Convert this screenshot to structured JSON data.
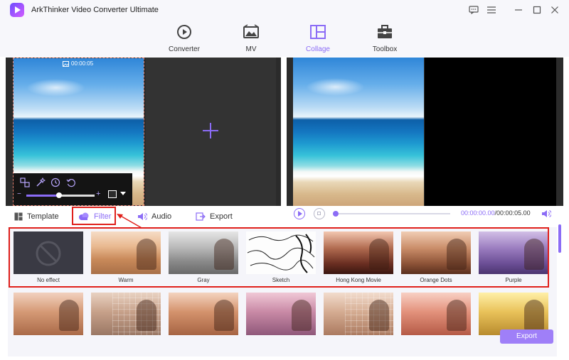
{
  "app": {
    "title": "ArkThinker Video Converter Ultimate"
  },
  "window_controls": [
    "feedback-icon",
    "menu-icon",
    "minimize-icon",
    "maximize-icon",
    "close-icon"
  ],
  "nav": {
    "tabs": [
      {
        "label": "Converter",
        "icon": "converter-icon"
      },
      {
        "label": "MV",
        "icon": "mv-icon"
      },
      {
        "label": "Collage",
        "icon": "collage-icon",
        "active": true
      },
      {
        "label": "Toolbox",
        "icon": "toolbox-icon"
      }
    ]
  },
  "preview": {
    "clip_duration": "00:00:05"
  },
  "tabs": {
    "template": "Template",
    "filter": "Filter",
    "audio": "Audio",
    "export": "Export"
  },
  "player": {
    "current_time": "00:00:00.00",
    "total_time": "/00:00:05.00"
  },
  "filters": {
    "row1": [
      "No effect",
      "Warm",
      "Gray",
      "Sketch",
      "Hong Kong Movie",
      "Orange Dots",
      "Purple"
    ]
  },
  "export_button": "Export",
  "colors": {
    "accent": "#8b6cf6",
    "highlight": "#e0201b"
  }
}
